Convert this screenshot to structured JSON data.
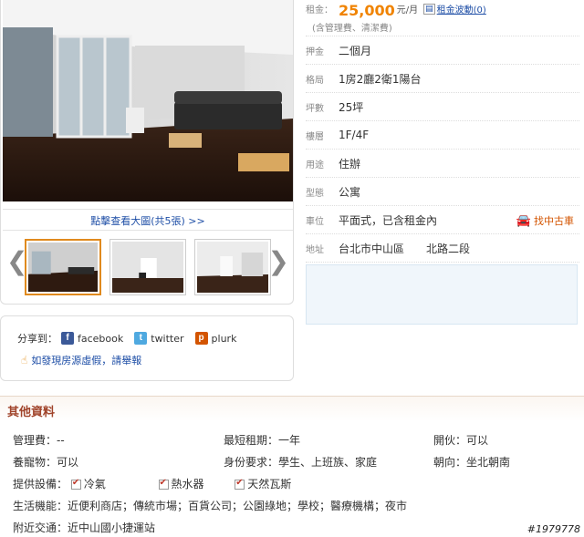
{
  "photos": {
    "view_large_link": "點擊查看大圖(共5張) >>",
    "prev_arrow": "❮",
    "next_arrow": "❯"
  },
  "share": {
    "label": "分享到：",
    "facebook": "facebook",
    "twitter": "twitter",
    "plurk": "plurk",
    "report": "如發現房源虛假，請舉報"
  },
  "details": {
    "rent_label": "租金：",
    "rent_value": "25,000",
    "rent_unit": "元/月",
    "rent_trend": "租金波動(0)",
    "rent_note": "(含管理費、清潔費)",
    "deposit_label": "押金",
    "deposit_value": "二個月",
    "layout_label": "格局",
    "layout_value": "1房2廳2衛1陽台",
    "area_label": "坪數",
    "area_value": "25坪",
    "floor_label": "樓層",
    "floor_value": "1F/4F",
    "use_label": "用途",
    "use_value": "住辦",
    "type_label": "型態",
    "type_value": "公寓",
    "parking_label": "車位",
    "parking_value": "平面式，已含租金內",
    "car_link": "找中古車",
    "address_label": "地址",
    "address_value": "台北市中山區　　北路二段"
  },
  "other": {
    "title": "其他資料",
    "mgmt_fee": "管理費：--",
    "min_lease": "最短租期：一年",
    "cooking": "開伙：可以",
    "pets": "養寵物：可以",
    "identity": "身份要求：學生、上班族、家庭",
    "orientation": "朝向：坐北朝南",
    "facilities_label": "提供設備：",
    "facility_1": "冷氣",
    "facility_2": "熱水器",
    "facility_3": "天然瓦斯",
    "living": "生活機能：近便利商店；傳統市場；百貨公司；公園綠地；學校；醫療機構；夜市",
    "transport": "附近交通：近中山國小捷運站"
  },
  "watermark": "#1979778",
  "colors": {
    "price": "#f08300",
    "link": "#1e4ea6",
    "section_title": "#a0432a"
  }
}
